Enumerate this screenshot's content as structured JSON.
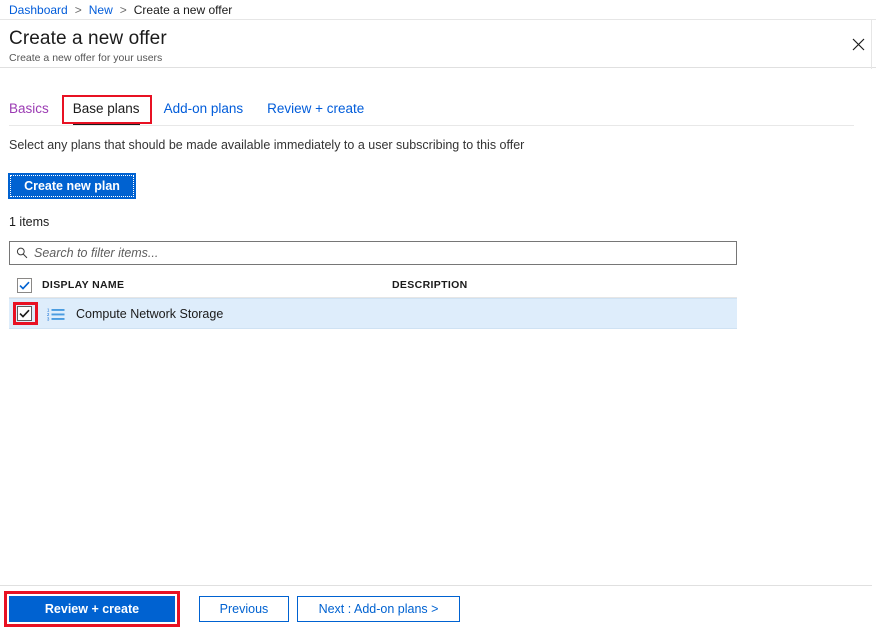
{
  "breadcrumb": {
    "items": [
      {
        "label": "Dashboard",
        "link": true
      },
      {
        "label": "New",
        "link": true
      },
      {
        "label": "Create a new offer",
        "link": false
      }
    ],
    "separator": ">"
  },
  "header": {
    "title": "Create a new offer",
    "subtitle": "Create a new offer for your users",
    "close_icon": "close-icon",
    "close_glyph": "✕"
  },
  "tabs": [
    {
      "label": "Basics",
      "state": "visited"
    },
    {
      "label": "Base plans",
      "state": "active"
    },
    {
      "label": "Add-on plans",
      "state": "link"
    },
    {
      "label": "Review + create",
      "state": "link"
    }
  ],
  "main": {
    "instruction": "Select any plans that should be made available immediately to a user subscribing to this offer",
    "create_plan_label": "Create new plan",
    "items_count": "1 items"
  },
  "search": {
    "placeholder": "Search to filter items...",
    "value": "",
    "icon": "search-icon"
  },
  "table": {
    "columns": [
      {
        "key": "display_name",
        "label": "DISPLAY NAME"
      },
      {
        "key": "description",
        "label": "DESCRIPTION"
      }
    ],
    "header_checkbox_checked": true,
    "rows": [
      {
        "checked": true,
        "icon": "numbered-list-icon",
        "display_name": "Compute Network Storage",
        "description": ""
      }
    ]
  },
  "footer": {
    "review_create_label": "Review + create",
    "previous_label": "Previous",
    "next_label": "Next : Add-on plans >"
  },
  "colors": {
    "accent_blue": "#0062d1",
    "link_blue": "#015cda",
    "visited_purple": "#9b3bb3",
    "annotation_red": "#e81123",
    "row_selected": "#deedfb",
    "text_primary": "#1b1b1b"
  }
}
